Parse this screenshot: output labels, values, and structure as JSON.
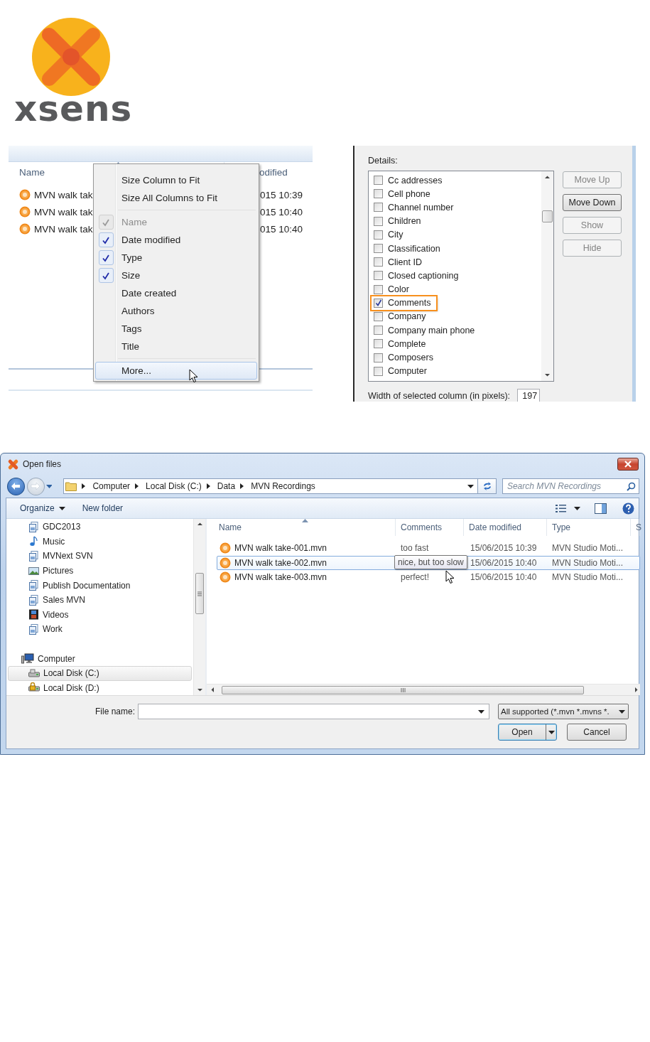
{
  "logo": {
    "wordmark": "xsens"
  },
  "column_menu_shot": {
    "header": {
      "name": "Name",
      "date_modified": "odified"
    },
    "files": [
      {
        "name": "MVN walk tak",
        "date_modified": "015 10:39"
      },
      {
        "name": "MVN walk tak",
        "date_modified": "015 10:40"
      },
      {
        "name": "MVN walk tak",
        "date_modified": "015 10:40"
      }
    ],
    "menu": {
      "actions": [
        {
          "label": "Size Column to Fit"
        },
        {
          "label": "Size All Columns to Fit"
        }
      ],
      "columns": [
        {
          "label": "Name",
          "checked": true,
          "disabled": true
        },
        {
          "label": "Date modified",
          "checked": true,
          "disabled": false
        },
        {
          "label": "Type",
          "checked": true,
          "disabled": false
        },
        {
          "label": "Size",
          "checked": true,
          "disabled": false
        },
        {
          "label": "Date created",
          "checked": false,
          "disabled": false
        },
        {
          "label": "Authors",
          "checked": false,
          "disabled": false
        },
        {
          "label": "Tags",
          "checked": false,
          "disabled": false
        },
        {
          "label": "Title",
          "checked": false,
          "disabled": false
        }
      ],
      "more": {
        "label": "More...",
        "selected": true
      }
    }
  },
  "details_shot": {
    "details_label": "Details:",
    "items": [
      {
        "label": "Cc addresses",
        "checked": false,
        "highlighted": false
      },
      {
        "label": "Cell phone",
        "checked": false,
        "highlighted": false
      },
      {
        "label": "Channel number",
        "checked": false,
        "highlighted": false
      },
      {
        "label": "Children",
        "checked": false,
        "highlighted": false
      },
      {
        "label": "City",
        "checked": false,
        "highlighted": false
      },
      {
        "label": "Classification",
        "checked": false,
        "highlighted": false
      },
      {
        "label": "Client ID",
        "checked": false,
        "highlighted": false
      },
      {
        "label": "Closed captioning",
        "checked": false,
        "highlighted": false
      },
      {
        "label": "Color",
        "checked": false,
        "highlighted": false
      },
      {
        "label": "Comments",
        "checked": true,
        "highlighted": true
      },
      {
        "label": "Company",
        "checked": false,
        "highlighted": false
      },
      {
        "label": "Company main phone",
        "checked": false,
        "highlighted": false
      },
      {
        "label": "Complete",
        "checked": false,
        "highlighted": false
      },
      {
        "label": "Composers",
        "checked": false,
        "highlighted": false
      },
      {
        "label": "Computer",
        "checked": false,
        "highlighted": false
      }
    ],
    "buttons": [
      {
        "label": "Move Up",
        "disabled": true
      },
      {
        "label": "Move Down",
        "disabled": false
      },
      {
        "label": "Show",
        "disabled": true
      },
      {
        "label": "Hide",
        "disabled": true
      }
    ],
    "width_label": "Width of selected column (in pixels):",
    "width_value": "197"
  },
  "open_dialog": {
    "title": "Open files",
    "breadcrumb": [
      "Computer",
      "Local Disk (C:)",
      "Data",
      "MVN Recordings"
    ],
    "search": {
      "placeholder": "Search MVN Recordings"
    },
    "toolbar": {
      "organize": "Organize",
      "new_folder": "New folder"
    },
    "nav": [
      {
        "label": "GDC2013",
        "kind": "library",
        "selected": false
      },
      {
        "label": "Music",
        "kind": "music",
        "selected": false
      },
      {
        "label": "MVNext SVN",
        "kind": "library",
        "selected": false
      },
      {
        "label": "Pictures",
        "kind": "pictures",
        "selected": false
      },
      {
        "label": "Publish Documentation",
        "kind": "library",
        "selected": false
      },
      {
        "label": "Sales MVN",
        "kind": "library",
        "selected": false
      },
      {
        "label": "Videos",
        "kind": "videos",
        "selected": false
      },
      {
        "label": "Work",
        "kind": "library",
        "selected": false
      },
      {
        "label": "Computer",
        "kind": "computer",
        "selected": false,
        "children": [
          {
            "label": "Local Disk (C:)",
            "kind": "drive",
            "selected": true
          },
          {
            "label": "Local Disk (D:)",
            "kind": "lockeddrive",
            "selected": false
          }
        ]
      }
    ],
    "columns": [
      "Name",
      "Comments",
      "Date modified",
      "Type",
      "S"
    ],
    "files": [
      {
        "name": "MVN walk take-001.mvn",
        "comments": "too fast",
        "date_modified": "15/06/2015 10:39",
        "type": "MVN Studio Moti...",
        "selected": false
      },
      {
        "name": "MVN walk take-002.mvn",
        "date_modified": "15/06/2015 10:40",
        "type": "MVN Studio Moti...",
        "selected": true
      },
      {
        "name": "MVN walk take-003.mvn",
        "comments": "perfect!",
        "date_modified": "15/06/2015 10:40",
        "type": "MVN Studio Moti...",
        "selected": false
      }
    ],
    "tooltip": "nice, but too slow",
    "file_name": {
      "label": "File name:"
    },
    "filter": {
      "value": "All supported (*.mvn *.mvns *."
    },
    "buttons": [
      {
        "label": "Open",
        "default": true
      },
      {
        "label": "Cancel",
        "default": false
      }
    ]
  }
}
